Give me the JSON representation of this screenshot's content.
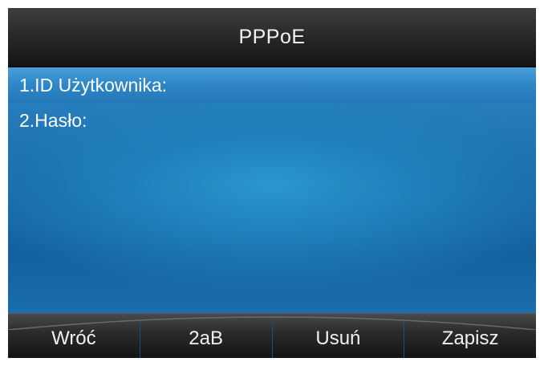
{
  "header": {
    "title": "PPPoE"
  },
  "menu": {
    "items": [
      {
        "label": "1.ID Użytkownika:"
      },
      {
        "label": "2.Hasło:"
      }
    ]
  },
  "softkeys": [
    {
      "label": "Wróć"
    },
    {
      "label": "2aB"
    },
    {
      "label": "Usuń"
    },
    {
      "label": "Zapisz"
    }
  ],
  "colors": {
    "accent": "#2f86c6",
    "background": "#1a6aa9",
    "bar": "#2a2a2a"
  }
}
